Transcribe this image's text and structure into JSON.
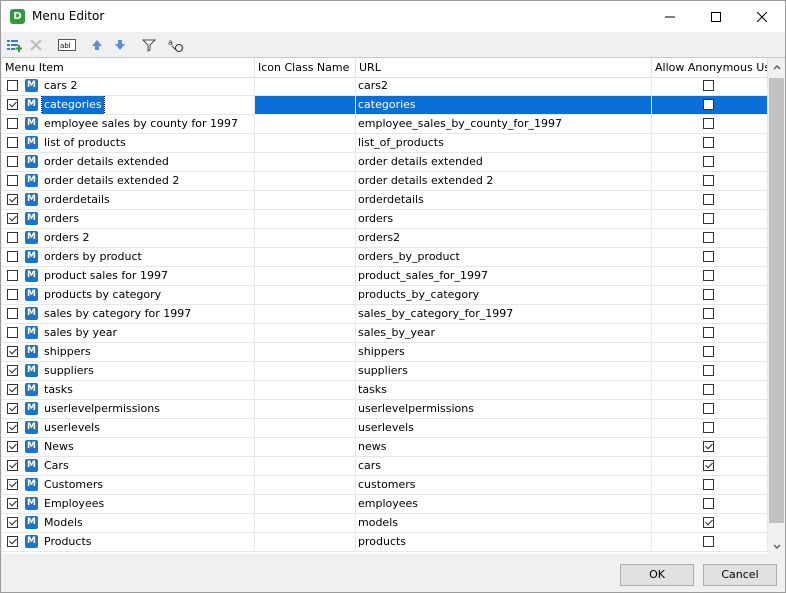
{
  "window": {
    "title": "Menu Editor"
  },
  "toolbar": {
    "text_glyph": "abl",
    "translate_glyph": "a"
  },
  "columns": [
    "Menu Item",
    "Icon Class Name",
    "URL",
    "Allow Anonymous User"
  ],
  "icon_letter": "M",
  "rows": [
    {
      "checked": false,
      "name": "cars 2",
      "icon_class": "",
      "url": "cars2",
      "anon": false,
      "selected": false
    },
    {
      "checked": true,
      "name": "categories",
      "icon_class": "",
      "url": "categories",
      "anon": false,
      "selected": true
    },
    {
      "checked": false,
      "name": "employee sales by county for 1997",
      "icon_class": "",
      "url": "employee_sales_by_county_for_1997",
      "anon": false,
      "selected": false
    },
    {
      "checked": false,
      "name": "list of products",
      "icon_class": "",
      "url": "list_of_products",
      "anon": false,
      "selected": false
    },
    {
      "checked": false,
      "name": "order details extended",
      "icon_class": "",
      "url": "order details extended",
      "anon": false,
      "selected": false
    },
    {
      "checked": false,
      "name": "order details extended 2",
      "icon_class": "",
      "url": "order details extended 2",
      "anon": false,
      "selected": false
    },
    {
      "checked": true,
      "name": "orderdetails",
      "icon_class": "",
      "url": "orderdetails",
      "anon": false,
      "selected": false
    },
    {
      "checked": true,
      "name": "orders",
      "icon_class": "",
      "url": "orders",
      "anon": false,
      "selected": false
    },
    {
      "checked": false,
      "name": "orders 2",
      "icon_class": "",
      "url": "orders2",
      "anon": false,
      "selected": false
    },
    {
      "checked": false,
      "name": "orders by product",
      "icon_class": "",
      "url": "orders_by_product",
      "anon": false,
      "selected": false
    },
    {
      "checked": false,
      "name": "product sales for 1997",
      "icon_class": "",
      "url": "product_sales_for_1997",
      "anon": false,
      "selected": false
    },
    {
      "checked": false,
      "name": "products by category",
      "icon_class": "",
      "url": "products_by_category",
      "anon": false,
      "selected": false
    },
    {
      "checked": false,
      "name": "sales by category for 1997",
      "icon_class": "",
      "url": "sales_by_category_for_1997",
      "anon": false,
      "selected": false
    },
    {
      "checked": false,
      "name": "sales by year",
      "icon_class": "",
      "url": "sales_by_year",
      "anon": false,
      "selected": false
    },
    {
      "checked": true,
      "name": "shippers",
      "icon_class": "",
      "url": "shippers",
      "anon": false,
      "selected": false
    },
    {
      "checked": true,
      "name": "suppliers",
      "icon_class": "",
      "url": "suppliers",
      "anon": false,
      "selected": false
    },
    {
      "checked": true,
      "name": "tasks",
      "icon_class": "",
      "url": "tasks",
      "anon": false,
      "selected": false
    },
    {
      "checked": true,
      "name": "userlevelpermissions",
      "icon_class": "",
      "url": "userlevelpermissions",
      "anon": false,
      "selected": false
    },
    {
      "checked": true,
      "name": "userlevels",
      "icon_class": "",
      "url": "userlevels",
      "anon": false,
      "selected": false
    },
    {
      "checked": true,
      "name": "News",
      "icon_class": "",
      "url": "news",
      "anon": true,
      "selected": false
    },
    {
      "checked": true,
      "name": "Cars",
      "icon_class": "",
      "url": "cars",
      "anon": true,
      "selected": false
    },
    {
      "checked": true,
      "name": "Customers",
      "icon_class": "",
      "url": "customers",
      "anon": false,
      "selected": false
    },
    {
      "checked": true,
      "name": "Employees",
      "icon_class": "",
      "url": "employees",
      "anon": false,
      "selected": false
    },
    {
      "checked": true,
      "name": "Models",
      "icon_class": "",
      "url": "models",
      "anon": true,
      "selected": false
    },
    {
      "checked": true,
      "name": "Products",
      "icon_class": "",
      "url": "products",
      "anon": false,
      "selected": false
    }
  ],
  "buttons": {
    "ok": "OK",
    "cancel": "Cancel"
  },
  "colors": {
    "selection": "#0a6fd6",
    "menu_icon": "#1e74c8",
    "app_icon": "#2e9c3a"
  }
}
